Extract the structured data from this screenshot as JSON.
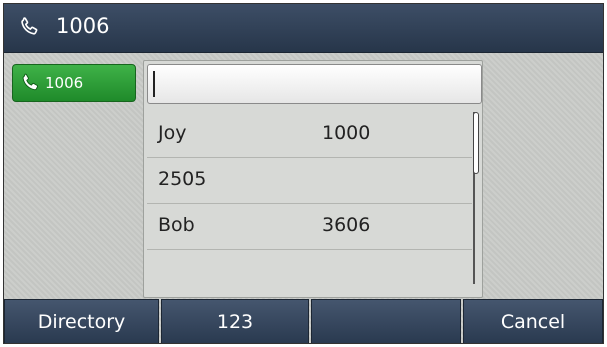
{
  "title": {
    "icon": "phone-handset-icon",
    "text": "1006"
  },
  "line_key": {
    "icon": "phone-handset-icon",
    "label": "1006",
    "color": "#2e9e38"
  },
  "search": {
    "value": "",
    "placeholder": ""
  },
  "results": [
    {
      "name": "Joy",
      "number": "1000"
    },
    {
      "name": "2505",
      "number": ""
    },
    {
      "name": "Bob",
      "number": "3606"
    }
  ],
  "softkeys": [
    {
      "label": "Directory"
    },
    {
      "label": "123"
    },
    {
      "label": ""
    },
    {
      "label": "Cancel"
    }
  ]
}
